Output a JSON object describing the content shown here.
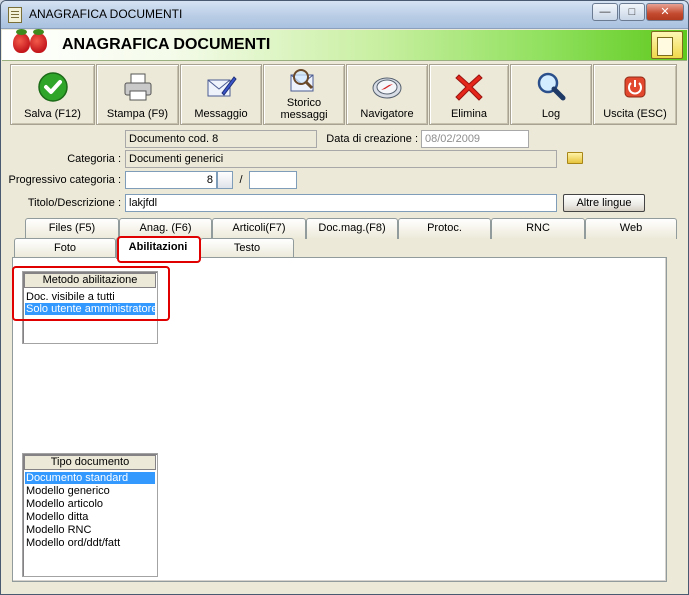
{
  "window": {
    "title": "ANAGRAFICA DOCUMENTI",
    "minimize_symbol": "—",
    "maximize_symbol": "□",
    "close_symbol": "✕"
  },
  "header": {
    "title": "ANAGRAFICA DOCUMENTI"
  },
  "toolbar": {
    "buttons": [
      {
        "label": "Salva (F12)",
        "icon": "check-icon"
      },
      {
        "label": "Stampa (F9)",
        "icon": "printer-icon"
      },
      {
        "label": "Messaggio",
        "icon": "envelope-pen-icon"
      },
      {
        "label": "Storico messaggi",
        "icon": "envelope-search-icon"
      },
      {
        "label": "Navigatore",
        "icon": "compass-icon"
      },
      {
        "label": "Elimina",
        "icon": "red-x-icon"
      },
      {
        "label": "Log",
        "icon": "magnifier-icon"
      },
      {
        "label": "Uscita (ESC)",
        "icon": "power-icon"
      }
    ]
  },
  "form": {
    "document_code": "Documento cod. 8",
    "creation_date_label": "Data di creazione :",
    "creation_date": "08/02/2009",
    "category_label": "Categoria :",
    "category": "Documenti generici",
    "progressive_label": "Progressivo categoria :",
    "progressive_value": "8",
    "slash": "/",
    "progressive_suffix": "",
    "title_label": "Titolo/Descrizione :",
    "title_value": "lakjfdl",
    "other_languages_button": "Altre lingue"
  },
  "tabs_row1": [
    "Files (F5)",
    "Anag. (F6)",
    "Articoli(F7)",
    "Doc.mag.(F8)",
    "Protoc.",
    "RNC",
    "Web"
  ],
  "tabs_row2": [
    "Foto",
    "Abilitazioni",
    "Testo"
  ],
  "active_tab": "Abilitazioni",
  "enable_method": {
    "header": "Metodo abilitazione",
    "items": [
      "Doc. visibile a tutti",
      "Solo utente amministratore"
    ],
    "selected_index": 1
  },
  "document_type": {
    "header": "Tipo documento",
    "items": [
      "Documento standard",
      "Modello generico",
      "Modello articolo",
      "Modello ditta",
      "Modello RNC",
      "Modello ord/ddt/fatt"
    ],
    "selected_index": 0
  },
  "colors": {
    "selection": "#3399ff",
    "highlight": "#e00000",
    "header_gradient_end": "#5ec91d"
  }
}
